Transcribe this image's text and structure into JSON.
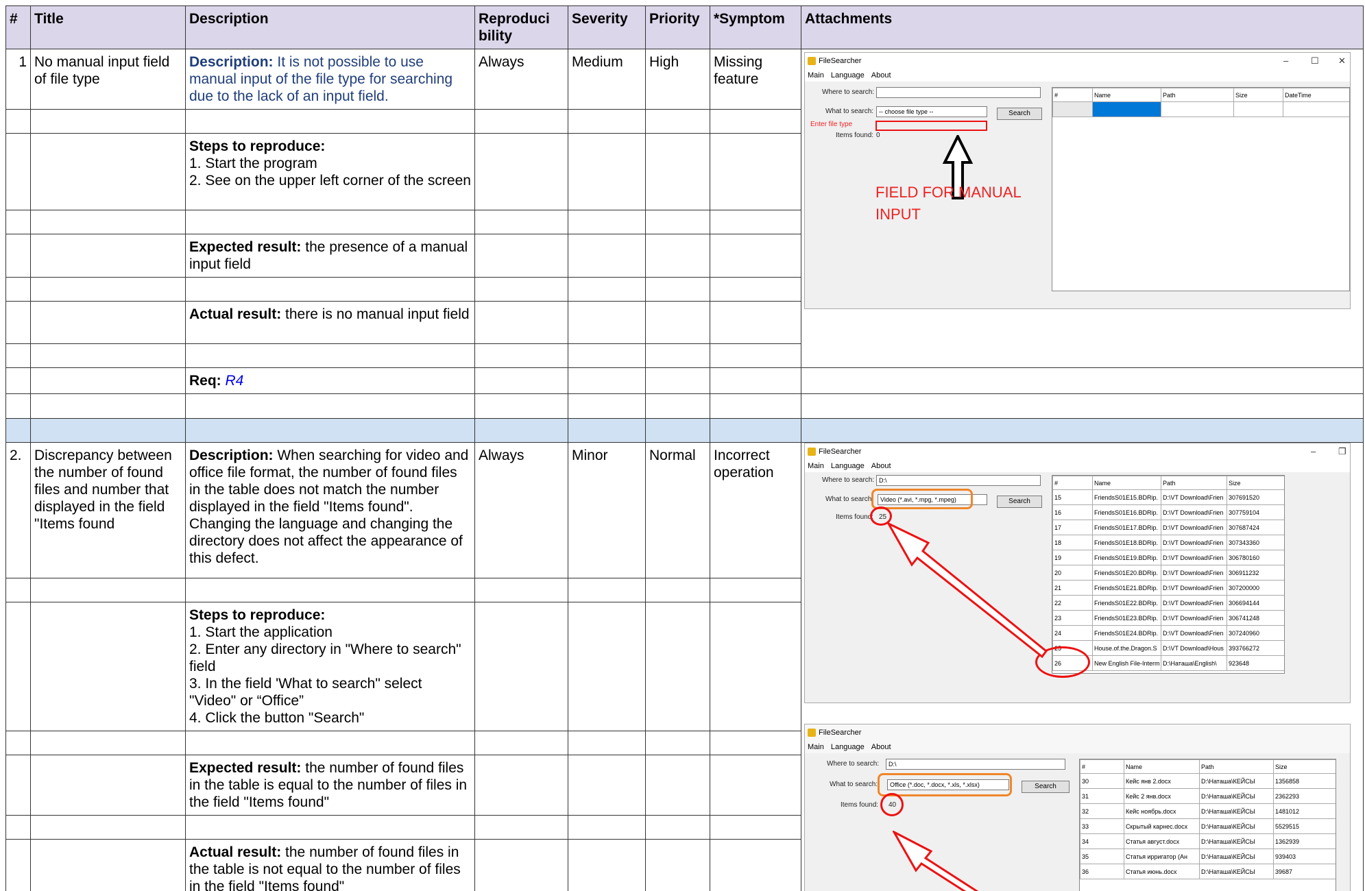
{
  "headers": {
    "num": "#",
    "title": "Title",
    "description": "Description",
    "reproducibility": "Reproduci bility",
    "severity": "Severity",
    "priority": "Priority",
    "symptom": "*Symptom",
    "attachments": "Attachments"
  },
  "bug1": {
    "num": "1",
    "title": "No manual input field of file type",
    "description_label": "Description:",
    "description_text": "It is not possible to use manual input of the file type for searching due to the lack of an input field.",
    "reproducibility": "Always",
    "severity": "Medium",
    "priority": "High",
    "symptom": "Missing feature",
    "steps_label": "Steps to reproduce:",
    "steps": [
      "1. Start the program",
      "2. See on the upper left corner of the screen"
    ],
    "expected_label": "Expected result:",
    "expected_text": "the presence of a manual input field",
    "actual_label": "Actual result:",
    "actual_text": "there is no manual input field",
    "req_label": "Req:",
    "req_value": "R4"
  },
  "bug2": {
    "num": "2.",
    "title": "Discrepancy between the number of found files and number that displayed in the field \"Items  found",
    "description_label": "Description:",
    "description_text": "When searching for video and office file format, the number of found files in the table does not  match the number displayed in the field \"Items found\". Changing the language and changing the directory does not affect the appearance of this defect.",
    "reproducibility": "Always",
    "severity": "Minor",
    "priority": "Normal",
    "symptom": "Incorrect operation",
    "steps_label": "Steps to reproduce:",
    "steps": [
      "1. Start the application",
      "2. Enter any directory in \"Where to search\" field",
      "3. In the field 'What to search\" select \"Video\" or “Office”",
      "4. Click the button \"Search\""
    ],
    "expected_label": "Expected result:",
    "expected_text": "the number of found files in the table is equal to the number of files in the field \"Items found\"",
    "actual_label": "Actual result:",
    "actual_text": "the number of found files in the  table is not equal to the number of files in the field \"Items found\""
  },
  "shot1": {
    "app_title": "FileSearcher",
    "menu": [
      "Main",
      "Language",
      "About"
    ],
    "where_label": "Where to search:",
    "what_label": "What to search:",
    "what_value": "-- choose file type --",
    "search_btn": "Search",
    "enter_label": "Enter file type",
    "items_label": "Items found:",
    "items_value": "0",
    "cols": [
      "#",
      "Name",
      "Path",
      "Size",
      "DateTime"
    ],
    "annotation": "FIELD FOR MANUAL INPUT"
  },
  "shot2": {
    "app_title": "FileSearcher",
    "menu": [
      "Main",
      "Language",
      "About"
    ],
    "where_label": "Where to search:",
    "where_value": "D:\\",
    "what_label": "What to search:",
    "what_value": "Video (*.avi, *.mpg, *.mpeg)",
    "search_btn": "Search",
    "items_label": "Items found:",
    "items_value": "25",
    "cols": [
      "#",
      "Name",
      "Path",
      "Size"
    ],
    "rows": [
      [
        "15",
        "FriendsS01E15.BDRip.",
        "D:\\VT Download\\Frien",
        "307691520"
      ],
      [
        "16",
        "FriendsS01E16.BDRip.",
        "D:\\VT Download\\Frien",
        "307759104"
      ],
      [
        "17",
        "FriendsS01E17.BDRip.",
        "D:\\VT Download\\Frien",
        "307687424"
      ],
      [
        "18",
        "FriendsS01E18.BDRip.",
        "D:\\VT Download\\Frien",
        "307343360"
      ],
      [
        "19",
        "FriendsS01E19.BDRip.",
        "D:\\VT Download\\Frien",
        "306780160"
      ],
      [
        "20",
        "FriendsS01E20.BDRip.",
        "D:\\VT Download\\Frien",
        "306911232"
      ],
      [
        "21",
        "FriendsS01E21.BDRip.",
        "D:\\VT Download\\Frien",
        "307200000"
      ],
      [
        "22",
        "FriendsS01E22.BDRip.",
        "D:\\VT Download\\Frien",
        "306694144"
      ],
      [
        "23",
        "FriendsS01E23.BDRip.",
        "D:\\VT Download\\Frien",
        "306741248"
      ],
      [
        "24",
        "FriendsS01E24.BDRip.",
        "D:\\VT Download\\Frien",
        "307240960"
      ],
      [
        "25",
        "House.of.the.Dragon.S",
        "D:\\VT Download\\Hous",
        "393766272"
      ],
      [
        "26",
        "New English File-Interm",
        "D:\\Наташа\\English\\",
        "923648"
      ]
    ]
  },
  "shot3": {
    "app_title": "FileSearcher",
    "menu": [
      "Main",
      "Language",
      "About"
    ],
    "where_label": "Where to search:",
    "where_value": "D:\\",
    "what_label": "What to search:",
    "what_value": "Office (*.doc, *.docx, *.xls, *.xlsx)",
    "search_btn": "Search",
    "items_label": "Items found:",
    "items_value": "40",
    "cols": [
      "#",
      "Name",
      "Path",
      "Size"
    ],
    "rows": [
      [
        "30",
        "Кейс янв 2.docx",
        "D:\\Наташа\\КЕЙСЫ",
        "1356858"
      ],
      [
        "31",
        "Кейс 2 янв.docx",
        "D:\\Наташа\\КЕЙСЫ",
        "2362293"
      ],
      [
        "32",
        "Кейс ноябрь.docx",
        "D:\\Наташа\\КЕЙСЫ",
        "1481012"
      ],
      [
        "33",
        "Скрытый карнес.docx",
        "D:\\Наташа\\КЕЙСЫ",
        "5529515"
      ],
      [
        "34",
        "Статья август.docx",
        "D:\\Наташа\\КЕЙСЫ",
        "1362939"
      ],
      [
        "35",
        "Статья ирригатор (Ан",
        "D:\\Наташа\\КЕЙСЫ",
        "939403"
      ],
      [
        "36",
        "Статья июнь.docx",
        "D:\\Наташа\\КЕЙСЫ",
        "39687"
      ]
    ]
  },
  "colors": {
    "header_bg": "#dcd6ea",
    "separator_bg": "#cfe1f2",
    "annotation_red": "#e11111",
    "annotation_orange": "#f0862a"
  }
}
